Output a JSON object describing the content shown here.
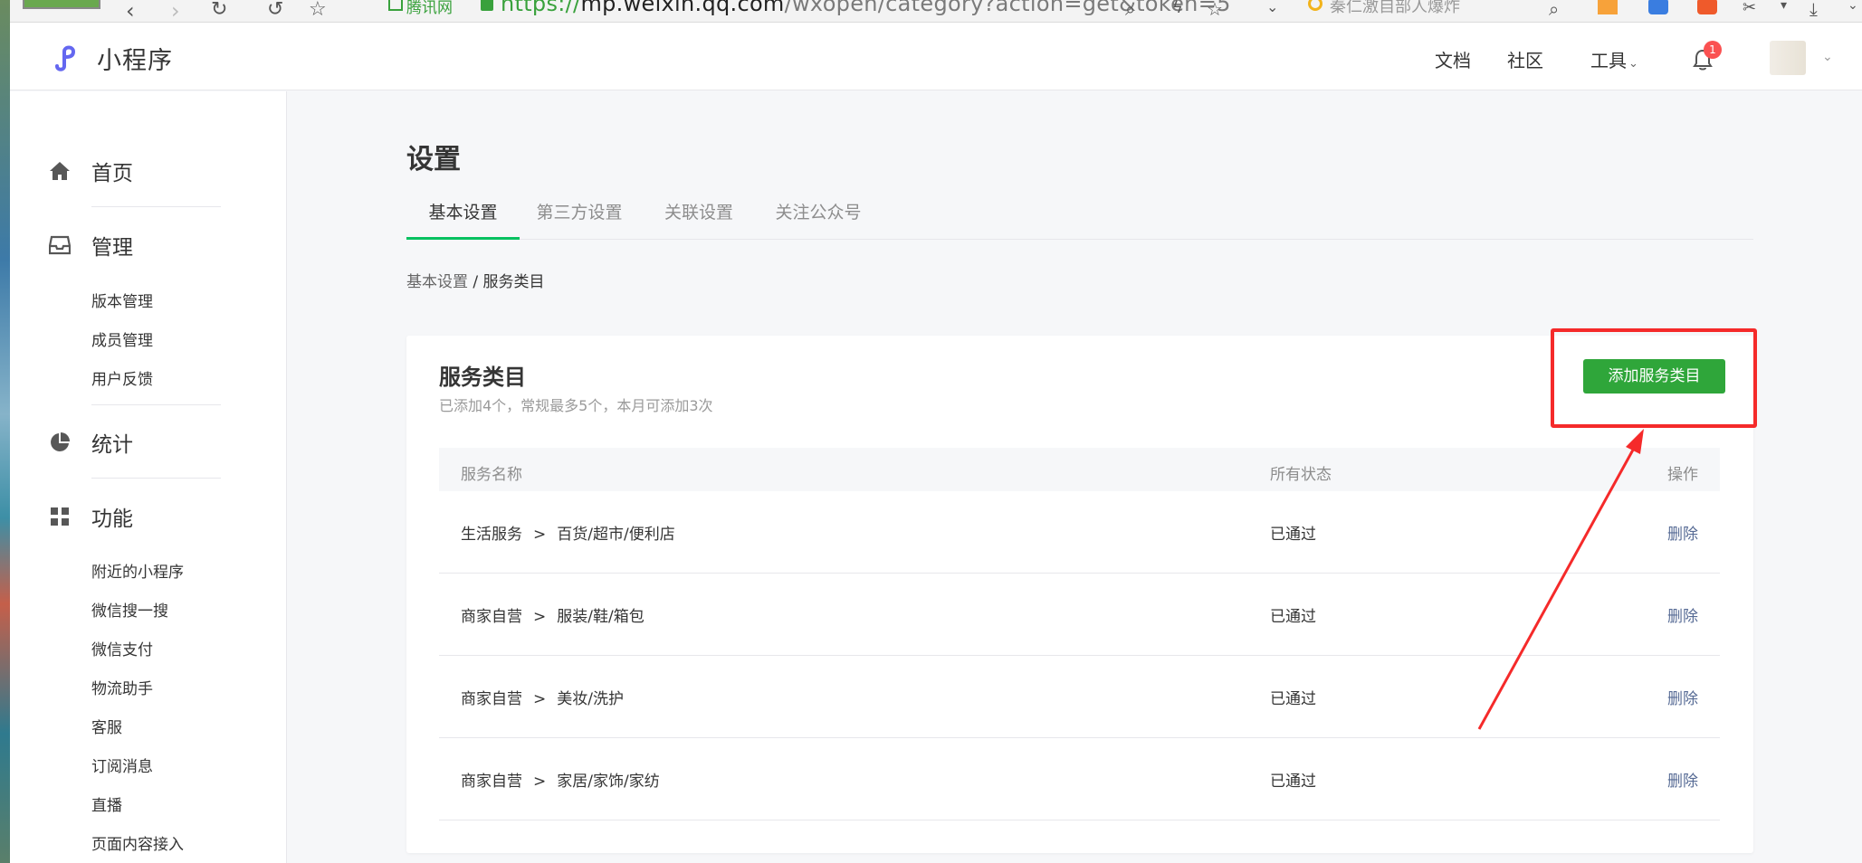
{
  "browser": {
    "brand_label": "腾讯网",
    "url_scheme": "https://",
    "url_host": "mp.weixin.qq.com",
    "url_path": "/wxopen/category?action=get&token=5",
    "search_text": "秦仁激自部人爆炸"
  },
  "header": {
    "title": "小程序",
    "links": [
      "文档",
      "社区",
      "工具"
    ],
    "notification_count": "1",
    "accent_color": "#6467f0"
  },
  "sidebar": {
    "home": "首页",
    "manage": {
      "label": "管理",
      "items": [
        "版本管理",
        "成员管理",
        "用户反馈"
      ]
    },
    "stats": "统计",
    "features": {
      "label": "功能",
      "items": [
        "附近的小程序",
        "微信搜一搜",
        "微信支付",
        "物流助手",
        "客服",
        "订阅消息",
        "直播",
        "页面内容接入"
      ]
    }
  },
  "main": {
    "page_title": "设置",
    "tabs": [
      "基本设置",
      "第三方设置",
      "关联设置",
      "关注公众号"
    ],
    "active_tab": "基本设置",
    "breadcrumb": {
      "parent": "基本设置",
      "separator": " / ",
      "current": "服务类目"
    },
    "card": {
      "title": "服务类目",
      "description": "已添加4个，常规最多5个，本月可添加3次",
      "add_button": "添加服务类目",
      "columns": [
        "服务名称",
        "所有状态",
        "操作"
      ],
      "rows": [
        {
          "category": "生活服务",
          "sub": "百货/超市/便利店",
          "status": "已通过",
          "action": "删除"
        },
        {
          "category": "商家自营",
          "sub": "服装/鞋/箱包",
          "status": "已通过",
          "action": "删除"
        },
        {
          "category": "商家自营",
          "sub": "美妆/洗护",
          "status": "已通过",
          "action": "删除"
        },
        {
          "category": "商家自营",
          "sub": "家居/家饰/家纺",
          "status": "已通过",
          "action": "删除"
        }
      ]
    }
  },
  "colors": {
    "primary_green": "#2fa63a",
    "tab_green": "#07c160",
    "link_blue": "#576b95",
    "annotation_red": "#f52a2a",
    "badge_red": "#fa5151"
  }
}
